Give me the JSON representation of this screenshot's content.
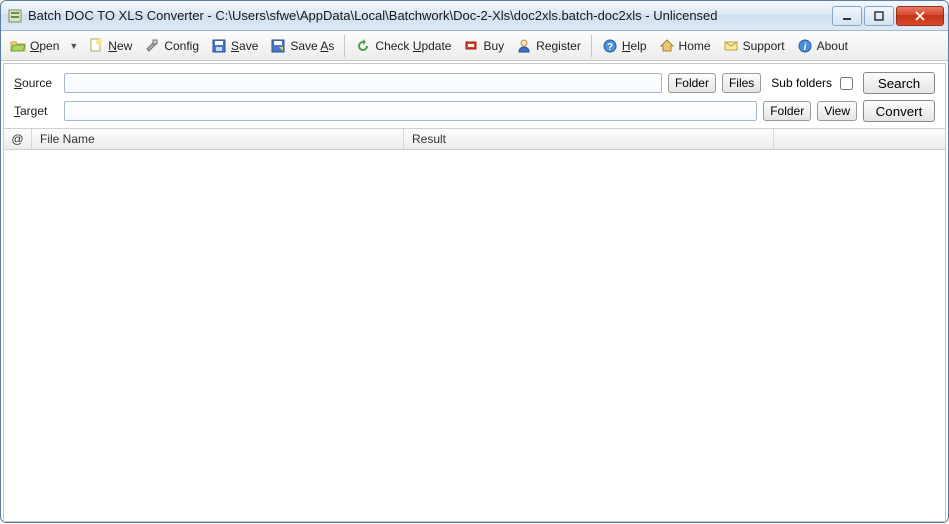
{
  "window": {
    "title": "Batch DOC TO XLS Converter - C:\\Users\\sfwe\\AppData\\Local\\Batchwork\\Doc-2-Xls\\doc2xls.batch-doc2xls - Unlicensed"
  },
  "toolbar": {
    "open": "Open",
    "new": "New",
    "config": "Config",
    "save": "Save",
    "saveas": "Save As",
    "check": "Check Update",
    "buy": "Buy",
    "register": "Register",
    "help": "Help",
    "home": "Home",
    "support": "Support",
    "about": "About"
  },
  "form": {
    "source_label": "Source",
    "target_label": "Target",
    "source_value": "",
    "target_value": "",
    "folder_btn": "Folder",
    "files_btn": "Files",
    "view_btn": "View",
    "subfolders_label": "Sub folders",
    "subfolders_checked": false,
    "search_btn": "Search",
    "convert_btn": "Convert"
  },
  "list": {
    "col_at": "@",
    "col_filename": "File Name",
    "col_result": "Result",
    "rows": []
  }
}
